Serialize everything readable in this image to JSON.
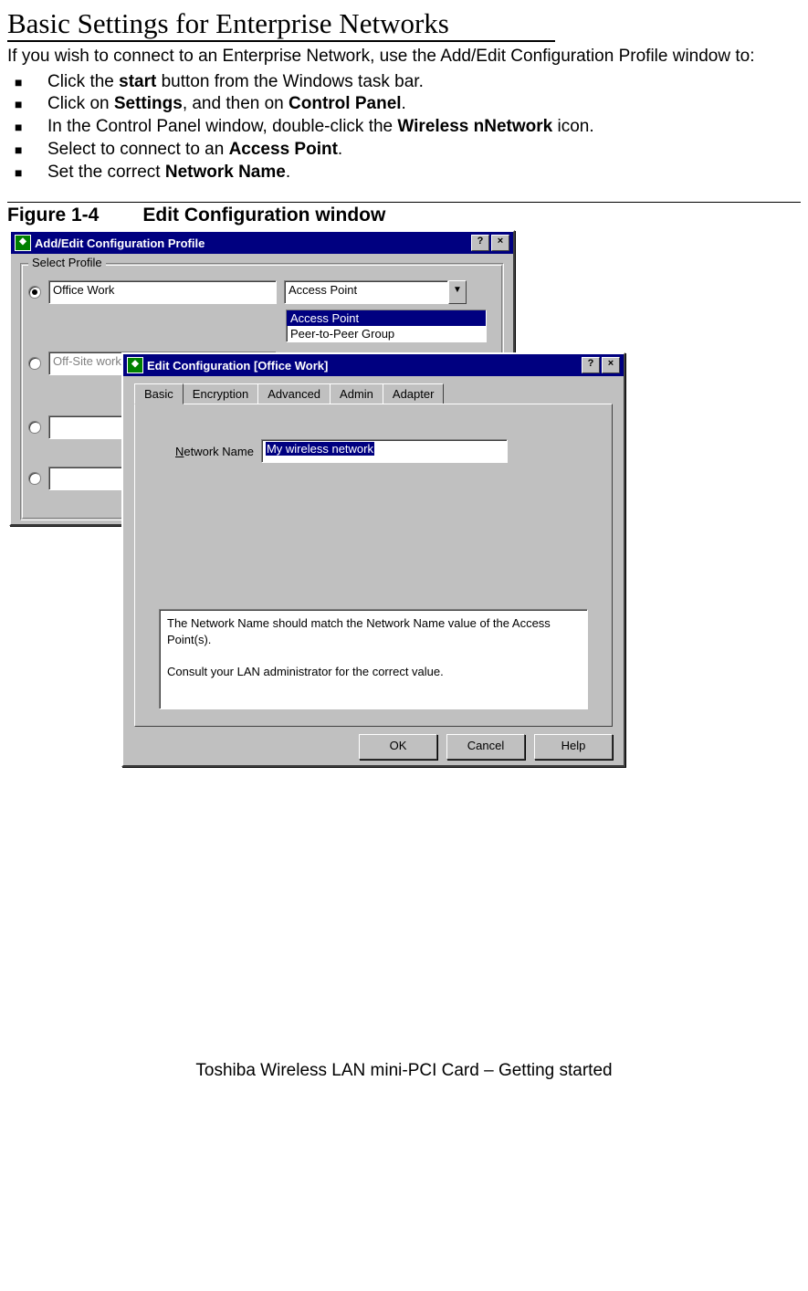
{
  "doc": {
    "title": "Basic Settings for Enterprise Networks",
    "intro": "If you wish to connect to an Enterprise Network, use the Add/Edit Configuration Profile window to:",
    "steps": [
      {
        "pre": "Click the ",
        "bold": "start",
        "post": " button from the Windows task bar."
      },
      {
        "pre": "Click on ",
        "bold": "Settings",
        "post": ", and then on ",
        "bold2": "Control Panel",
        "post2": "."
      },
      {
        "pre": "In the Control Panel window, double-click the ",
        "bold": "Wireless nNetwork",
        "post": " icon."
      },
      {
        "pre": "Select to connect to an ",
        "bold": "Access Point",
        "post": "."
      },
      {
        "pre": "Set the correct ",
        "bold": "Network Name",
        "post": "."
      }
    ],
    "figure_label": "Figure 1-4",
    "figure_title": "Edit Configuration window",
    "footer": "Toshiba Wireless LAN mini-PCI Card – Getting started"
  },
  "dlg1": {
    "title": "Add/Edit Configuration Profile",
    "help_btn": "?",
    "close_btn": "×",
    "group": "Select Profile",
    "profiles": [
      {
        "name": "Office Work",
        "checked": true,
        "enabled": true
      },
      {
        "name": "Off-Site workgroup",
        "checked": false,
        "enabled": false
      },
      {
        "name": "",
        "checked": false,
        "enabled": true
      },
      {
        "name": "",
        "checked": false,
        "enabled": true
      }
    ],
    "combo_value": "Access Point",
    "combo_options": [
      "Access Point",
      "Peer-to-Peer Group"
    ],
    "combo_selected_index": 0
  },
  "dlg2": {
    "title": "Edit Configuration [Office Work]",
    "help_btn": "?",
    "close_btn": "×",
    "tabs": [
      "Basic",
      "Encryption",
      "Advanced",
      "Admin",
      "Adapter"
    ],
    "active_tab": "Basic",
    "network_name_label": "Network Name",
    "network_name_value": "My wireless network",
    "info_text": "The Network Name should match the Network Name value of the Access Point(s).\n\nConsult your LAN administrator for the correct value.",
    "buttons": {
      "ok": "OK",
      "cancel": "Cancel",
      "help": "Help"
    }
  }
}
